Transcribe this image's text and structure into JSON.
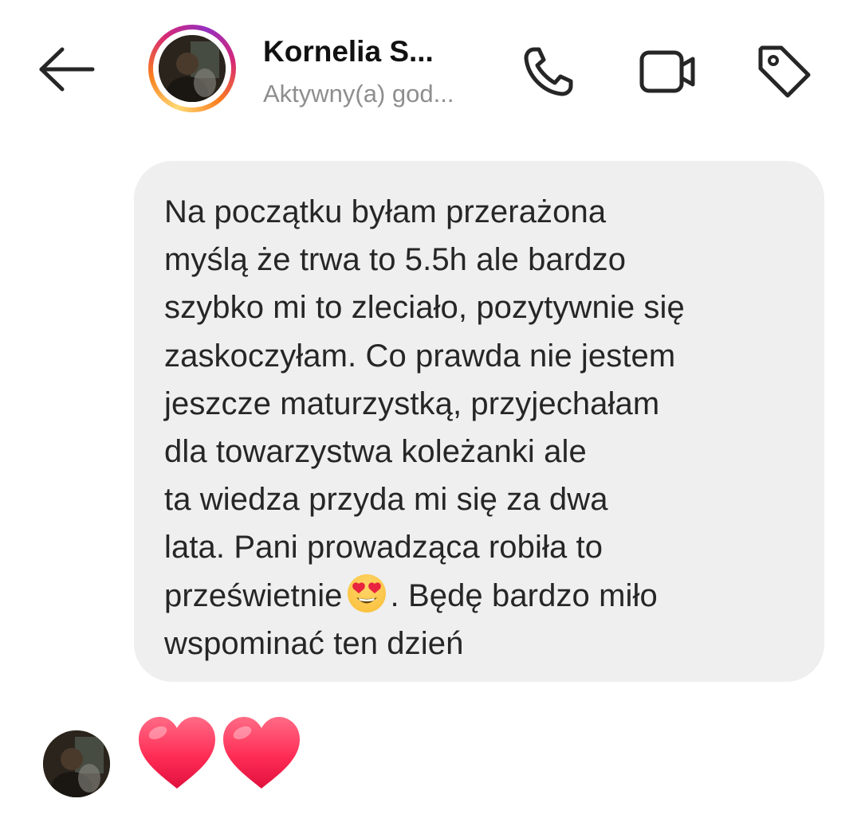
{
  "header": {
    "back_icon": "arrow-left-icon",
    "contact_name": "Kornelia S...",
    "contact_status": "Aktywny(a) god...",
    "call_icon": "phone-icon",
    "video_icon": "video-camera-icon",
    "tag_icon": "tag-icon"
  },
  "message": {
    "lines": [
      "Na początku byłam przerażona",
      "myślą że trwa to 5.5h ale bardzo",
      "szybko mi to zleciało, pozytywnie się",
      "zaskoczyłam. Co prawda nie jestem",
      "jeszcze maturzystką, przyjechałam",
      "dla towarzystwa koleżanki ale",
      "ta wiedza przyda mi się za dwa",
      "lata. Pani prowadząca robiła to",
      "prześwietnie",
      ". Będę bardzo miło",
      "wspominać ten dzień"
    ],
    "inline_emoji": "heart-eyes-emoji",
    "bubble_color": "#efefef"
  },
  "reaction": {
    "emojis": [
      "red-heart-emoji",
      "red-heart-emoji"
    ],
    "heart_color": "#ff2d55"
  },
  "colors": {
    "status_gray": "#8e8e8e",
    "text": "#262626",
    "ring_gradient": [
      "#feda75",
      "#fa7e1e",
      "#d62976",
      "#962fbf"
    ]
  }
}
